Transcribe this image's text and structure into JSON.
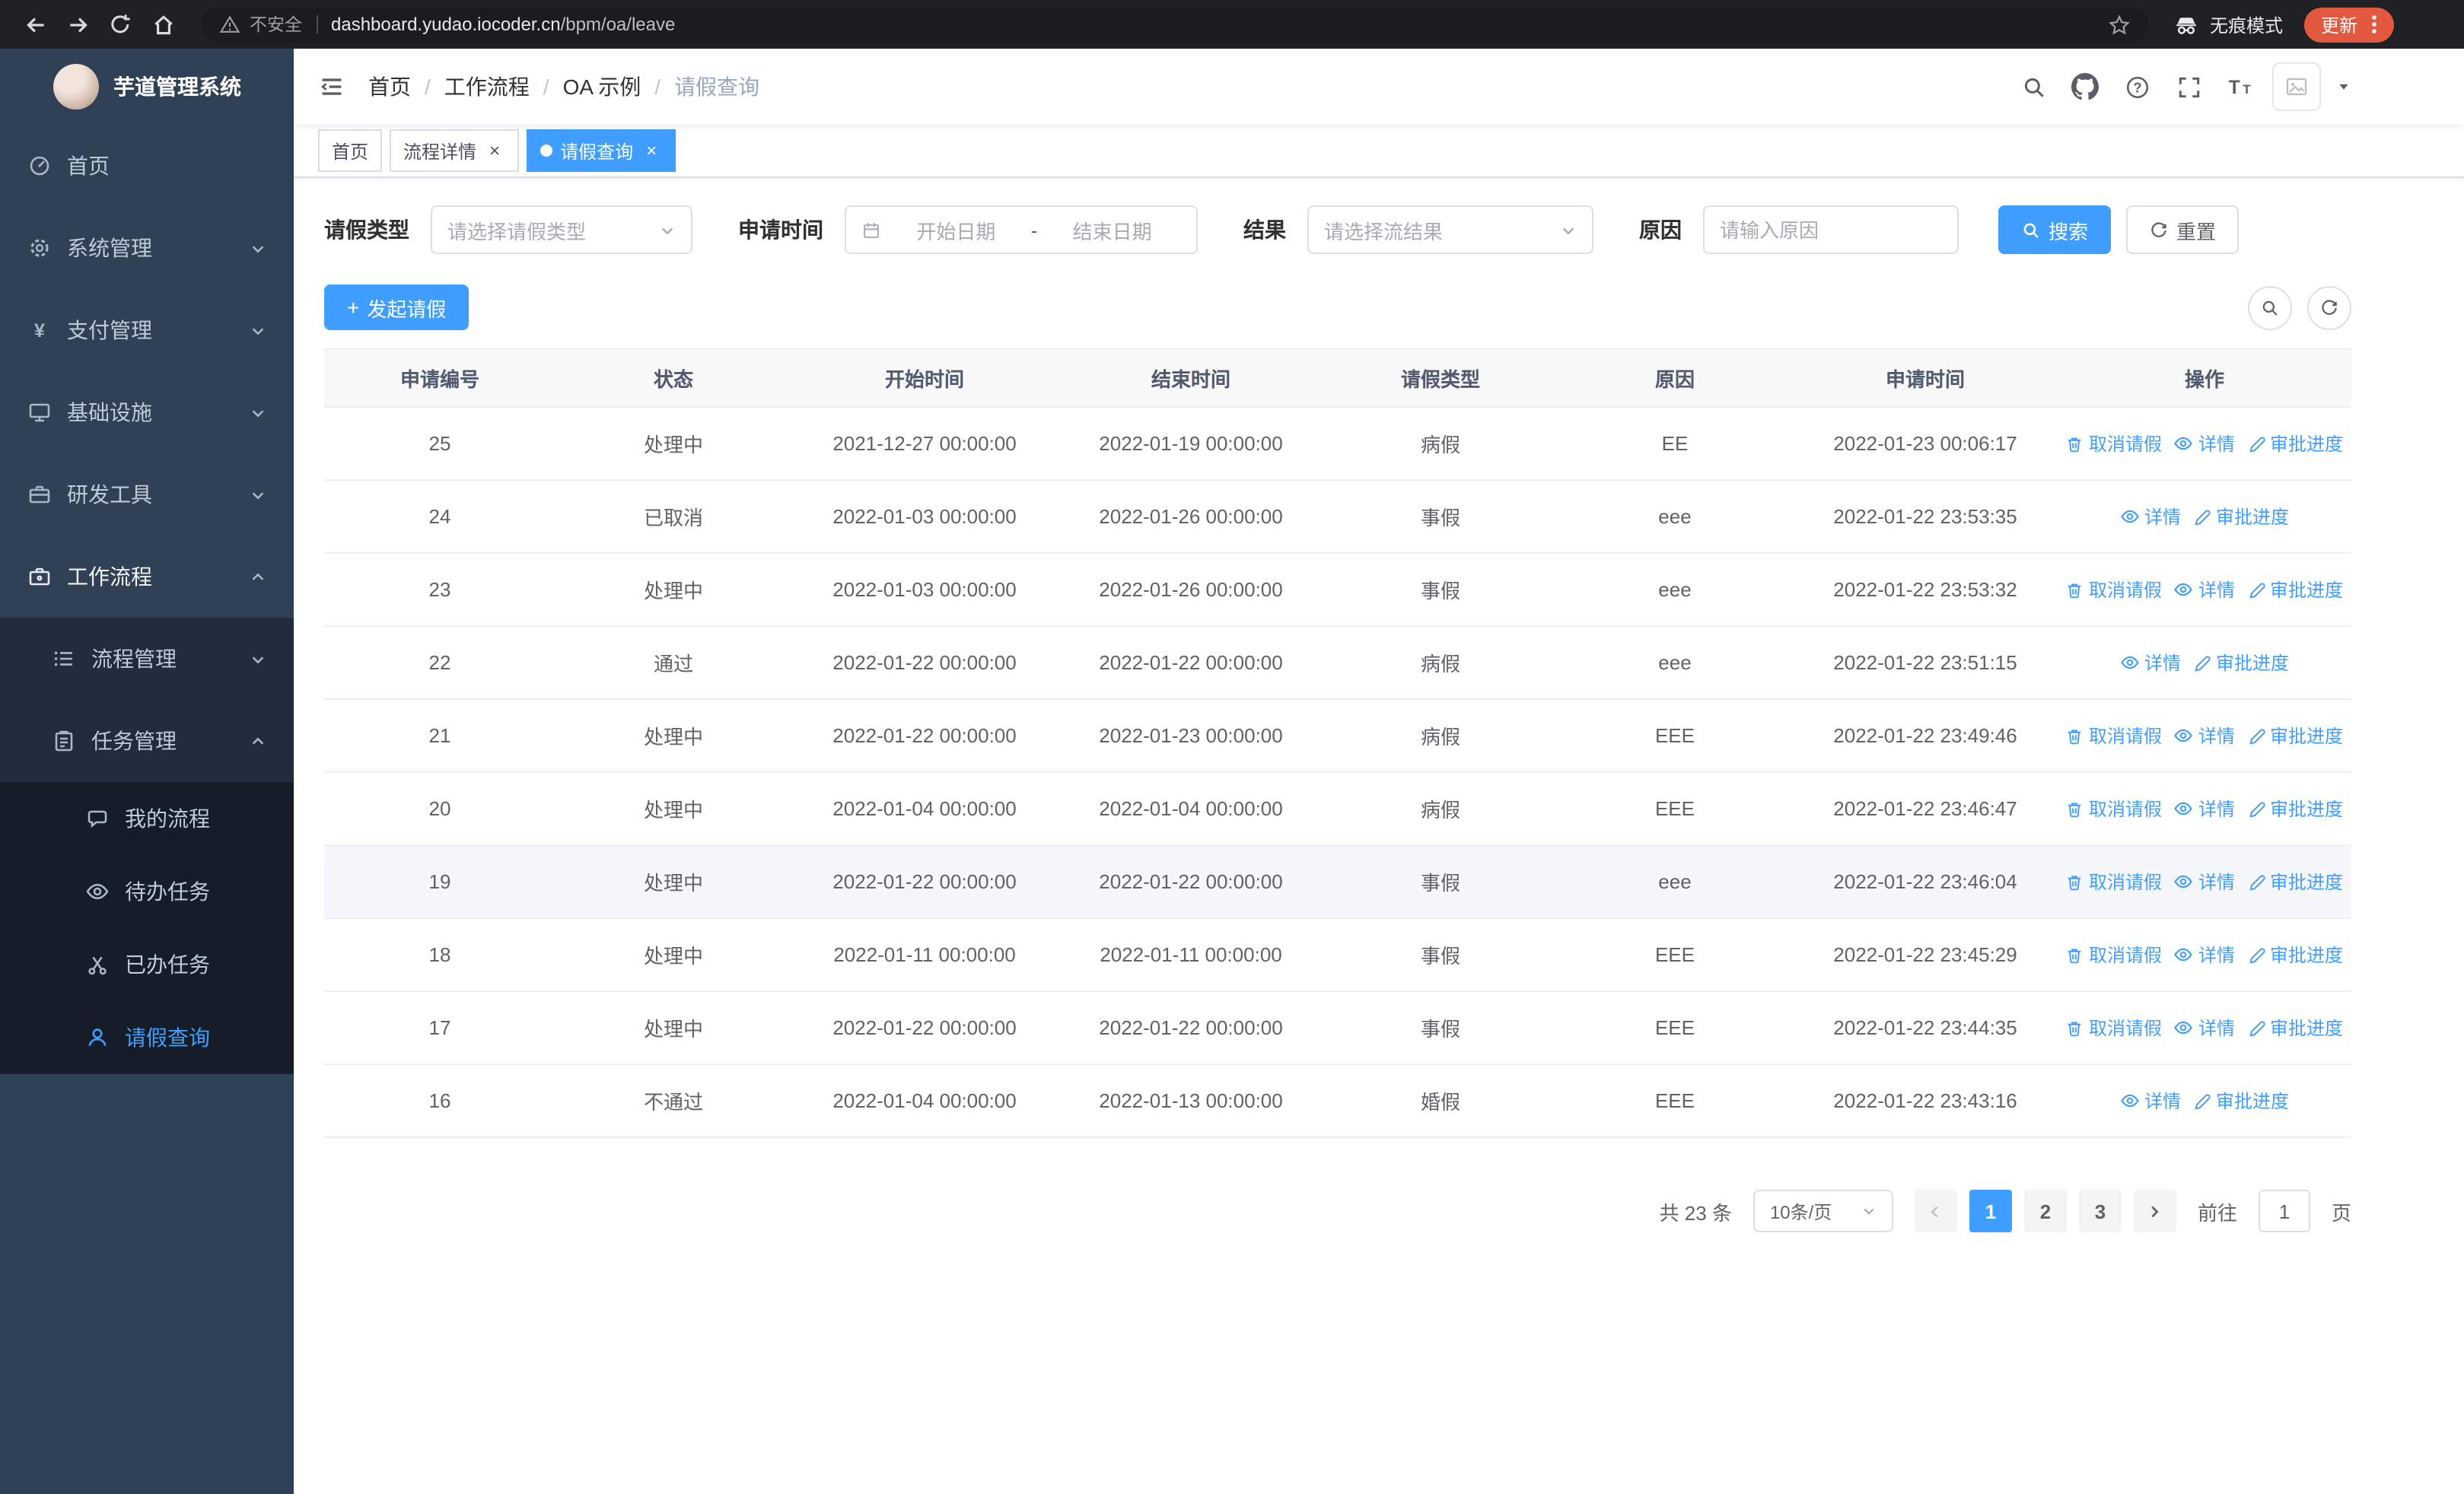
{
  "browser": {
    "security_label": "不安全",
    "url_host": "dashboard.yudao.iocoder.cn",
    "url_path": "/bpm/oa/leave",
    "incognito_label": "无痕模式",
    "update_label": "更新"
  },
  "sidebar": {
    "logo_title": "芋道管理系统",
    "items": [
      {
        "label": "首页"
      },
      {
        "label": "系统管理"
      },
      {
        "label": "支付管理"
      },
      {
        "label": "基础设施"
      },
      {
        "label": "研发工具"
      },
      {
        "label": "工作流程"
      },
      {
        "label": "流程管理"
      },
      {
        "label": "任务管理"
      },
      {
        "label": "我的流程"
      },
      {
        "label": "待办任务"
      },
      {
        "label": "已办任务"
      },
      {
        "label": "请假查询"
      }
    ]
  },
  "header": {
    "breadcrumb": [
      "首页",
      "工作流程",
      "OA 示例",
      "请假查询"
    ],
    "breadcrumb_separator": "/"
  },
  "tabs": [
    {
      "label": "首页"
    },
    {
      "label": "流程详情"
    },
    {
      "label": "请假查询"
    }
  ],
  "filters": {
    "leave_type_label": "请假类型",
    "leave_type_placeholder": "请选择请假类型",
    "apply_time_label": "申请时间",
    "start_date_placeholder": "开始日期",
    "range_separator": "-",
    "end_date_placeholder": "结束日期",
    "result_label": "结果",
    "result_placeholder": "请选择流结果",
    "reason_label": "原因",
    "reason_placeholder": "请输入原因",
    "search_button": "搜索",
    "reset_button": "重置"
  },
  "toolbar": {
    "create_button": "发起请假"
  },
  "table": {
    "columns": [
      "申请编号",
      "状态",
      "开始时间",
      "结束时间",
      "请假类型",
      "原因",
      "申请时间",
      "操作"
    ],
    "actions": {
      "cancel": {
        "label": "取消请假",
        "icon": "delete-icon"
      },
      "detail": {
        "label": "详情",
        "icon": "view-icon"
      },
      "progress": {
        "label": "审批进度",
        "icon": "edit-icon"
      }
    },
    "highlighted_row_id": "19",
    "rows": [
      {
        "id": "25",
        "status": "处理中",
        "start": "2021-12-27 00:00:00",
        "end": "2022-01-19 00:00:00",
        "type": "病假",
        "reason": "EE",
        "applied": "2022-01-23 00:06:17",
        "actions": [
          "cancel",
          "detail",
          "progress"
        ]
      },
      {
        "id": "24",
        "status": "已取消",
        "start": "2022-01-03 00:00:00",
        "end": "2022-01-26 00:00:00",
        "type": "事假",
        "reason": "eee",
        "applied": "2022-01-22 23:53:35",
        "actions": [
          "detail",
          "progress"
        ]
      },
      {
        "id": "23",
        "status": "处理中",
        "start": "2022-01-03 00:00:00",
        "end": "2022-01-26 00:00:00",
        "type": "事假",
        "reason": "eee",
        "applied": "2022-01-22 23:53:32",
        "actions": [
          "cancel",
          "detail",
          "progress"
        ]
      },
      {
        "id": "22",
        "status": "通过",
        "start": "2022-01-22 00:00:00",
        "end": "2022-01-22 00:00:00",
        "type": "病假",
        "reason": "eee",
        "applied": "2022-01-22 23:51:15",
        "actions": [
          "detail",
          "progress"
        ]
      },
      {
        "id": "21",
        "status": "处理中",
        "start": "2022-01-22 00:00:00",
        "end": "2022-01-23 00:00:00",
        "type": "病假",
        "reason": "EEE",
        "applied": "2022-01-22 23:49:46",
        "actions": [
          "cancel",
          "detail",
          "progress"
        ]
      },
      {
        "id": "20",
        "status": "处理中",
        "start": "2022-01-04 00:00:00",
        "end": "2022-01-04 00:00:00",
        "type": "病假",
        "reason": "EEE",
        "applied": "2022-01-22 23:46:47",
        "actions": [
          "cancel",
          "detail",
          "progress"
        ]
      },
      {
        "id": "19",
        "status": "处理中",
        "start": "2022-01-22 00:00:00",
        "end": "2022-01-22 00:00:00",
        "type": "事假",
        "reason": "eee",
        "applied": "2022-01-22 23:46:04",
        "actions": [
          "cancel",
          "detail",
          "progress"
        ]
      },
      {
        "id": "18",
        "status": "处理中",
        "start": "2022-01-11 00:00:00",
        "end": "2022-01-11 00:00:00",
        "type": "事假",
        "reason": "EEE",
        "applied": "2022-01-22 23:45:29",
        "actions": [
          "cancel",
          "detail",
          "progress"
        ]
      },
      {
        "id": "17",
        "status": "处理中",
        "start": "2022-01-22 00:00:00",
        "end": "2022-01-22 00:00:00",
        "type": "事假",
        "reason": "EEE",
        "applied": "2022-01-22 23:44:35",
        "actions": [
          "cancel",
          "detail",
          "progress"
        ]
      },
      {
        "id": "16",
        "status": "不通过",
        "start": "2022-01-04 00:00:00",
        "end": "2022-01-13 00:00:00",
        "type": "婚假",
        "reason": "EEE",
        "applied": "2022-01-22 23:43:16",
        "actions": [
          "detail",
          "progress"
        ]
      }
    ]
  },
  "pagination": {
    "total_text": "共 23 条",
    "page_size_text": "10条/页",
    "pages": [
      "1",
      "2",
      "3"
    ],
    "active_page": "1",
    "goto_label": "前往",
    "goto_value": "1",
    "goto_suffix": "页"
  },
  "colors": {
    "primary": "#409eff",
    "sidebar_bg": "#304156",
    "update_badge": "#e2593f"
  }
}
